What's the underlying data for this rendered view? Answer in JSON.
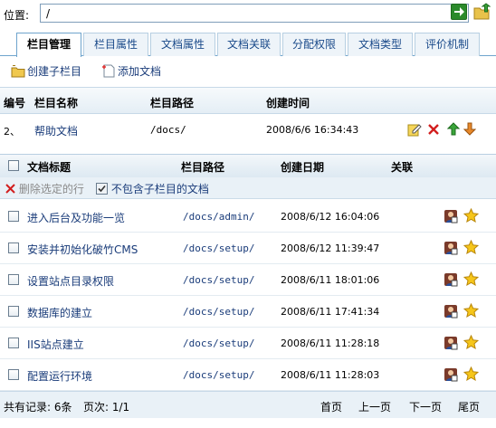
{
  "address": {
    "label": "位置:",
    "value": "/"
  },
  "tabs": [
    {
      "label": "栏目管理"
    },
    {
      "label": "栏目属性"
    },
    {
      "label": "文档属性"
    },
    {
      "label": "文档关联"
    },
    {
      "label": "分配权限"
    },
    {
      "label": "文档类型"
    },
    {
      "label": "评价机制"
    }
  ],
  "toolbar": {
    "create_child": "创建子栏目",
    "add_doc": "添加文档"
  },
  "category_header": {
    "id": "编号",
    "name": "栏目名称",
    "path": "栏目路径",
    "created": "创建时间"
  },
  "category_row": {
    "id": "2、",
    "name": "帮助文档",
    "path": "/docs/",
    "created": "2008/6/6 16:34:43"
  },
  "doc_header": {
    "title": "文档标题",
    "path": "栏目路径",
    "date": "创建日期",
    "relation": "关联"
  },
  "actions": {
    "delete": "删除选定的行",
    "exclude": "不包含子栏目的文档"
  },
  "docs": [
    {
      "title": "进入后台及功能一览",
      "path": "/docs/admin/",
      "date": "2008/6/12 16:04:06"
    },
    {
      "title": "安装并初始化破竹CMS",
      "path": "/docs/setup/",
      "date": "2008/6/12 11:39:47"
    },
    {
      "title": "设置站点目录权限",
      "path": "/docs/setup/",
      "date": "2008/6/11 18:01:06"
    },
    {
      "title": "数据库的建立",
      "path": "/docs/setup/",
      "date": "2008/6/11 17:41:34"
    },
    {
      "title": "IIS站点建立",
      "path": "/docs/setup/",
      "date": "2008/6/11 11:28:18"
    },
    {
      "title": "配置运行环境",
      "path": "/docs/setup/",
      "date": "2008/6/11 11:28:03"
    }
  ],
  "footer": {
    "total": "共有记录: 6条",
    "page": "页次: 1/1",
    "first": "首页",
    "prev": "上一页",
    "next": "下一页",
    "last": "尾页"
  },
  "colors": {
    "tab_border": "#6fa4cd",
    "link": "#1a3c7a",
    "header_bg": "#e4eef5"
  },
  "icons": [
    "arrow-right-icon",
    "folder-up-icon",
    "folder-add-icon",
    "document-add-icon",
    "edit-icon",
    "delete-icon",
    "arrow-up-icon",
    "arrow-down-icon",
    "user-icon",
    "star-icon",
    "checkbox-icon"
  ]
}
